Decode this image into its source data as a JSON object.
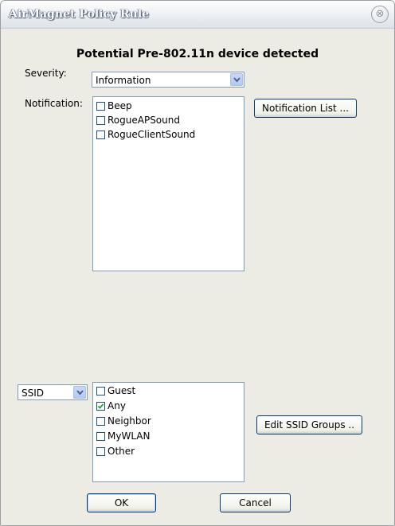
{
  "window": {
    "title": "AirMagnet Policy Rule",
    "close_glyph": "⊗"
  },
  "heading": "Potential Pre-802.11n device detected",
  "severity": {
    "label": "Severity:",
    "value": "Information"
  },
  "notification": {
    "label": "Notification:",
    "button_label": "Notification List ...",
    "items": [
      {
        "label": "Beep",
        "checked": false
      },
      {
        "label": "RogueAPSound",
        "checked": false
      },
      {
        "label": "RogueClientSound",
        "checked": false
      }
    ]
  },
  "ssid": {
    "selector_value": "SSID",
    "button_label": "Edit SSID Groups ..",
    "items": [
      {
        "label": "Guest",
        "checked": false
      },
      {
        "label": "Any",
        "checked": true
      },
      {
        "label": "Neighbor",
        "checked": false
      },
      {
        "label": "MyWLAN",
        "checked": false
      },
      {
        "label": "Other",
        "checked": false
      }
    ]
  },
  "footer": {
    "ok_label": "OK",
    "cancel_label": "Cancel"
  },
  "colors": {
    "dialog_bg": "#ecebe4",
    "button_border": "#003c74",
    "field_border": "#7f9db9",
    "combo_arrow": "#4d6185"
  },
  "icons": {
    "close": "close-icon",
    "dropdown": "chevron-down-icon",
    "check": "checkmark-icon"
  }
}
